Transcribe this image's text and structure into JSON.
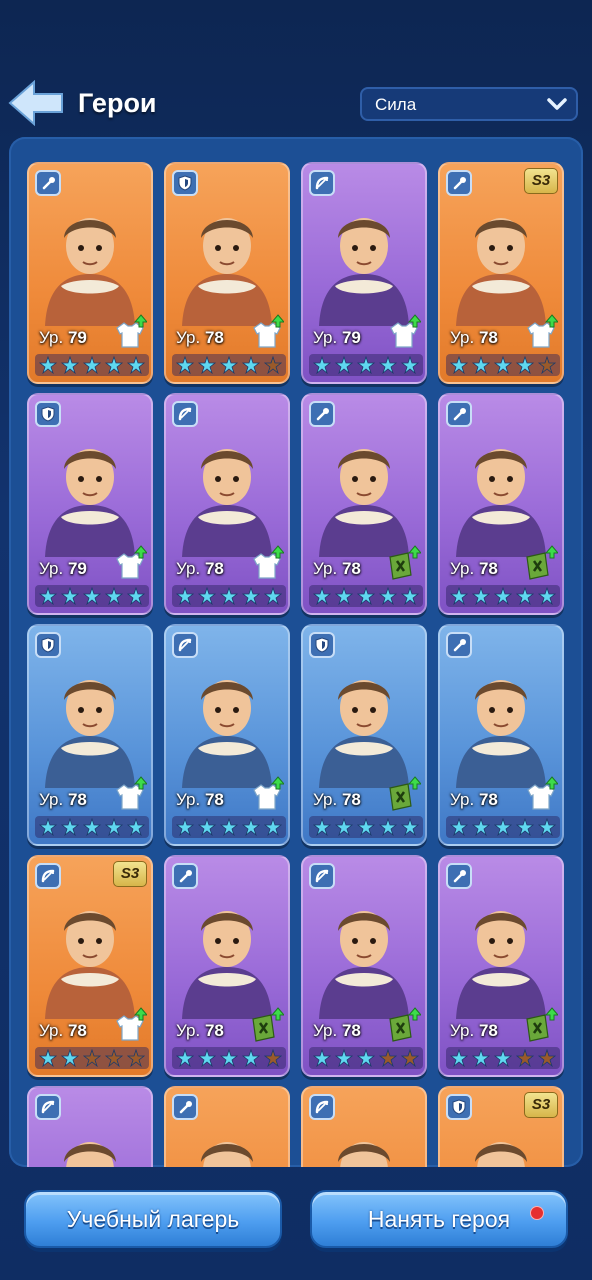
{
  "header": {
    "title": "Герои",
    "back_icon": "back-arrow-icon"
  },
  "sort": {
    "selected": "Сила"
  },
  "level_prefix": "Ур.",
  "heroes": [
    {
      "level": "79",
      "bg": "orange",
      "cls": "staff",
      "season": "",
      "gear": "shirt",
      "stars": [
        1,
        1,
        1,
        1,
        1
      ]
    },
    {
      "level": "78",
      "bg": "orange",
      "cls": "shield",
      "season": "",
      "gear": "shirt",
      "stars": [
        1,
        1,
        1,
        1,
        0
      ]
    },
    {
      "level": "79",
      "bg": "purple",
      "cls": "bow",
      "season": "",
      "gear": "shirt",
      "stars": [
        1,
        1,
        1,
        1,
        1
      ]
    },
    {
      "level": "78",
      "bg": "orange",
      "cls": "staff",
      "season": "S3",
      "gear": "shirt",
      "stars": [
        1,
        1,
        1,
        1,
        0
      ]
    },
    {
      "level": "79",
      "bg": "purple",
      "cls": "shield",
      "season": "",
      "gear": "shirt",
      "stars": [
        1,
        1,
        1,
        1,
        1
      ]
    },
    {
      "level": "78",
      "bg": "purple",
      "cls": "bow",
      "season": "",
      "gear": "shirt",
      "stars": [
        1,
        1,
        1,
        1,
        1
      ]
    },
    {
      "level": "78",
      "bg": "purple",
      "cls": "staff",
      "season": "",
      "gear": "book",
      "stars": [
        1,
        1,
        1,
        1,
        1
      ]
    },
    {
      "level": "78",
      "bg": "purple",
      "cls": "staff",
      "season": "",
      "gear": "book",
      "stars": [
        1,
        1,
        1,
        1,
        1
      ]
    },
    {
      "level": "78",
      "bg": "blue",
      "cls": "shield",
      "season": "",
      "gear": "shirt",
      "stars": [
        1,
        1,
        1,
        1,
        1
      ]
    },
    {
      "level": "78",
      "bg": "blue",
      "cls": "bow",
      "season": "",
      "gear": "shirt",
      "stars": [
        1,
        1,
        1,
        1,
        1
      ]
    },
    {
      "level": "78",
      "bg": "blue",
      "cls": "shield",
      "season": "",
      "gear": "book",
      "stars": [
        1,
        1,
        1,
        1,
        1
      ]
    },
    {
      "level": "78",
      "bg": "blue",
      "cls": "staff",
      "season": "",
      "gear": "shirt",
      "stars": [
        1,
        1,
        1,
        1,
        1
      ]
    },
    {
      "level": "78",
      "bg": "orange",
      "cls": "bow",
      "season": "S3",
      "gear": "shirt",
      "stars": [
        1,
        1,
        0,
        0,
        0
      ]
    },
    {
      "level": "78",
      "bg": "purple",
      "cls": "staff",
      "season": "",
      "gear": "book",
      "stars": [
        1,
        1,
        1,
        1,
        0
      ]
    },
    {
      "level": "78",
      "bg": "purple",
      "cls": "bow",
      "season": "",
      "gear": "book",
      "stars": [
        1,
        1,
        1,
        0,
        0
      ]
    },
    {
      "level": "78",
      "bg": "purple",
      "cls": "staff",
      "season": "",
      "gear": "book",
      "stars": [
        1,
        1,
        1,
        0,
        0
      ]
    },
    {
      "level": "",
      "bg": "purple",
      "cls": "bow",
      "season": "",
      "gear": "",
      "stars": []
    },
    {
      "level": "",
      "bg": "orange",
      "cls": "staff",
      "season": "",
      "gear": "",
      "stars": []
    },
    {
      "level": "",
      "bg": "orange",
      "cls": "bow",
      "season": "",
      "gear": "",
      "stars": []
    },
    {
      "level": "",
      "bg": "orange",
      "cls": "shield",
      "season": "S3",
      "gear": "",
      "stars": []
    }
  ],
  "buttons": {
    "training_camp": "Учебный лагерь",
    "hire_hero": "Нанять героя"
  },
  "colors": {
    "star_full": "#5fd8f0",
    "star_empty": "#9a5a2a",
    "accent": "#4e9ef0"
  }
}
